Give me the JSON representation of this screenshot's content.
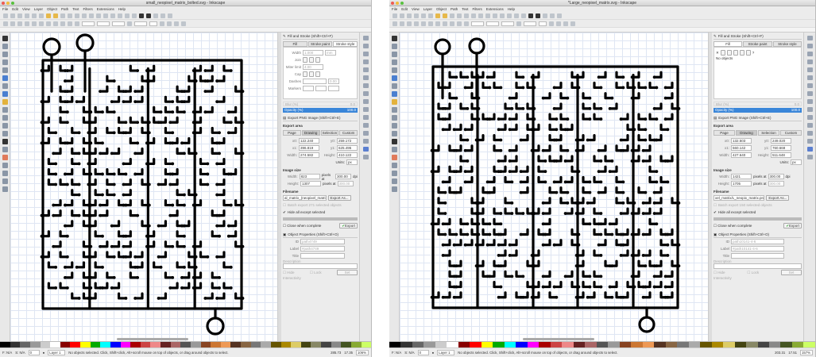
{
  "windows": [
    {
      "title": "small_neopixel_matrix_bolted.svg - Inkscape",
      "menu": [
        "File",
        "Edit",
        "View",
        "Layer",
        "Object",
        "Path",
        "Text",
        "Filters",
        "Extensions",
        "Help"
      ],
      "fill_stroke": {
        "header": "Fill and Stroke (Shift+Ctrl+F)",
        "tabs": [
          "Fill",
          "Stroke paint",
          "Stroke style"
        ],
        "active_tab": 2,
        "no_objects": "",
        "stroke_style": {
          "width_label": "Width",
          "width_value": "1.000",
          "width_unit": "mm",
          "join_label": "Join",
          "miter_label": "Miter limit",
          "miter_value": "4.00",
          "cap_label": "Cap",
          "dashes_label": "Dashes",
          "dashes_value": "0.00",
          "markers_label": "Markers"
        },
        "blur_label": "Blur (%)",
        "blur_value": "0.0",
        "opacity_label": "Opacity (%)",
        "opacity_value": "100.0"
      },
      "export": {
        "header": "Export PNG Image (Shift+Ctrl+E)",
        "area_label": "Export area",
        "area_tabs": [
          "Page",
          "Drawing",
          "Selection",
          "Custom"
        ],
        "x0": "122.240",
        "y0": "259.172",
        "x1": "396.819",
        "y1": "625.495",
        "width": "274.582",
        "height": "410.122",
        "units_label": "Units:",
        "units": "px",
        "image_size_label": "Image size",
        "img_width": "823",
        "img_height": "1307",
        "dpi": "300.00",
        "pixels_at": "pixels at",
        "dpi_unit": "dpi",
        "filename_label": "Filename",
        "filename": "al_matrix_(neopixel_matrix).png",
        "export_as": "Export As...",
        "batch": "Batch export 271 selected objects",
        "hide": "Hide all except selected",
        "close": "Close when complete",
        "export_btn": "Export"
      },
      "objprops": {
        "header": "Object Properties (Shift+Ctrl+O)",
        "id_label": "ID",
        "id": "path4749",
        "label_label": "Label",
        "label": "#path4749",
        "title_label": "Title",
        "desc_label": "Description",
        "hide": "Hide",
        "lock": "Lock",
        "set": "Set",
        "interactivity": "Interactivity"
      },
      "status": {
        "fill": "N/A",
        "stroke": "N/A",
        "opacity": "0",
        "layer": "Layer 1",
        "message": "No objects selected. Click, Shift+click, Alt+scroll mouse on top of objects, or drag around objects to select.",
        "x": "285.73",
        "y": "17.35",
        "zoom": "106%"
      }
    },
    {
      "title": "*Large_neopixel_matrix.svg - Inkscape",
      "menu": [
        "File",
        "Edit",
        "View",
        "Layer",
        "Object",
        "Path",
        "Text",
        "Filters",
        "Extensions",
        "Help"
      ],
      "fill_stroke": {
        "header": "Fill and Stroke (Shift+Ctrl+F)",
        "tabs": [
          "Fill",
          "Stroke paint",
          "Stroke style"
        ],
        "active_tab": 0,
        "no_objects": "No objects",
        "stroke_style": {
          "width_label": "",
          "width_value": "",
          "width_unit": "",
          "join_label": "",
          "miter_label": "",
          "miter_value": "",
          "cap_label": "",
          "dashes_label": "",
          "dashes_value": "",
          "markers_label": ""
        },
        "blur_label": "Blur (%)",
        "blur_value": "0.0",
        "opacity_label": "Opacity (%)",
        "opacity_value": "100.0"
      },
      "export": {
        "header": "Export PNG Image (Shift+Ctrl+E)",
        "area_label": "Export area",
        "area_tabs": [
          "Page",
          "Drawing",
          "Selection",
          "Custom"
        ],
        "x0": "132.503",
        "y0": "249.020",
        "x1": "560.142",
        "y1": "760.668",
        "width": "427.640",
        "height": "511.648",
        "units_label": "Units:",
        "units": "px",
        "image_size_label": "Image size",
        "img_width": "1421",
        "img_height": "1705",
        "dpi": "300.00",
        "pixels_at": "pixels at",
        "dpi_unit": "dpi",
        "filename_label": "Filename",
        "filename": "xel_matrix/L_neopix_matrix.png",
        "export_as": "Export As...",
        "batch": "Batch export 150 selected objects",
        "hide": "Hide all except selected",
        "close": "Close when complete",
        "export_btn": "Export"
      },
      "objprops": {
        "header": "Object Properties (Shift+Ctrl+O)",
        "id_label": "ID",
        "id": "path10141-4-6",
        "label_label": "Label",
        "label": "#path10141-4-6",
        "title_label": "Title",
        "desc_label": "Description",
        "hide": "Hide",
        "lock": "Lock",
        "set": "Set",
        "interactivity": "Interactivity"
      },
      "status": {
        "fill": "N/A",
        "stroke": "N/A",
        "opacity": "0",
        "layer": "Layer 1",
        "message": "No objects selected. Click, Shift+click, Alt+scroll mouse on top of objects, or drag around objects to select.",
        "x": "203.31",
        "y": "17.51",
        "zoom": "157%"
      }
    }
  ]
}
